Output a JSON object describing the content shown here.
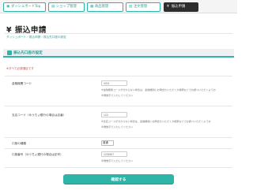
{
  "nav": {
    "tabs": [
      {
        "icon": "▣",
        "label": "ダッシュボードTop",
        "active": false
      },
      {
        "icon": "▤",
        "label": "ショップ管理",
        "active": false
      },
      {
        "icon": "▦",
        "label": "商品管理",
        "active": false
      },
      {
        "icon": "▥",
        "label": "注文管理",
        "active": false
      },
      {
        "icon": "¥",
        "label": "振込申請",
        "active": true
      }
    ]
  },
  "page": {
    "title": "¥ 振込申請",
    "breadcrumb": "ダッシュボード › 振込申請 › 振込先口座の設定"
  },
  "section": {
    "title": "振込先口座の設定"
  },
  "form": {
    "required_note": "※すべて必須項目です",
    "bank_code": {
      "label": "金融機関コード",
      "placeholder": "0001",
      "description": "※金融機関コードが分からない場合は、金融機関にお問合せいただくか検索などでお調べいただくようお",
      "hint": "半角数字で入力してください"
    },
    "branch_code": {
      "label": "支店コード（ゆうちょ銀行の場合は店番）",
      "placeholder": "123",
      "description": "※支店コードが分からない場合は、金融機関にお問合せいただくか検索などでお調べいただくようお",
      "hint": "半角数字で入力してください"
    },
    "account_type": {
      "label": "口座の種類",
      "selected": "普通"
    },
    "account_number": {
      "label": "口座番号（ゆうちょ銀行の場合は記号）",
      "placeholder": "1234567",
      "hint": "半角数字で入力してください"
    },
    "confirm_label": "確認する"
  }
}
